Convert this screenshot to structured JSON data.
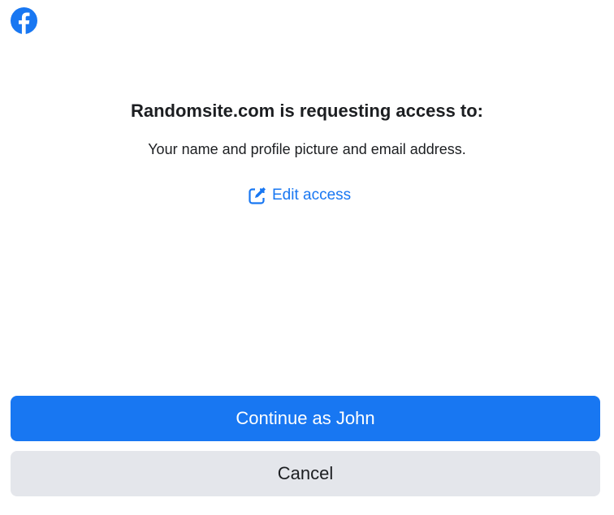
{
  "brand": {
    "logo_icon": "facebook-logo-icon",
    "color": "#1877f2"
  },
  "dialog": {
    "title": "Randomsite.com is requesting access to:",
    "description": "Your name and profile picture and email address.",
    "edit_link": {
      "icon": "edit-icon",
      "label": "Edit access"
    }
  },
  "actions": {
    "continue_label": "Continue as John",
    "cancel_label": "Cancel",
    "primary_color": "#1877f2",
    "secondary_color": "#e4e6eb"
  }
}
